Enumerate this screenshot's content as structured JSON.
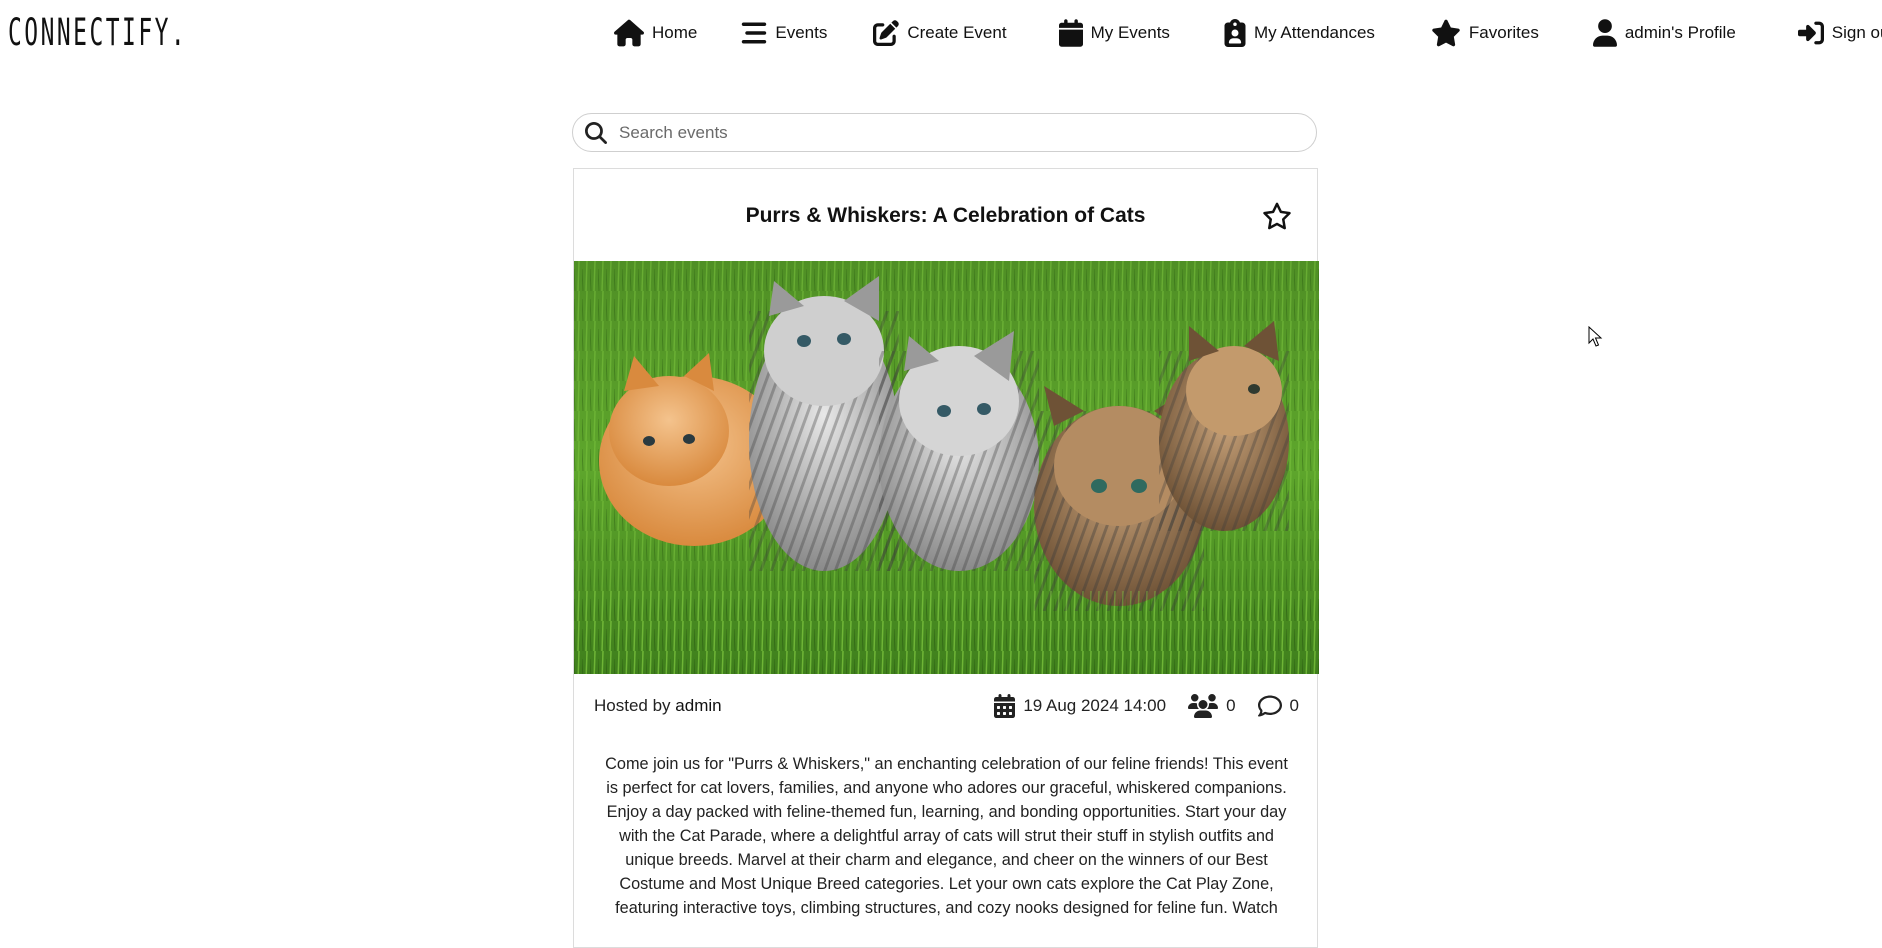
{
  "brand": {
    "name": "CONNECTIFY."
  },
  "nav": {
    "home": "Home",
    "events": "Events",
    "create_event": "Create Event",
    "my_events": "My Events",
    "my_attendances": "My Attendances",
    "favorites": "Favorites",
    "profile": "admin's Profile",
    "sign_out": "Sign out"
  },
  "search": {
    "placeholder": "Search events",
    "value": ""
  },
  "event": {
    "title": "Purrs & Whiskers: A Celebration of Cats",
    "image_alt": "Five kittens on grass",
    "hosted_by_label": "Hosted by",
    "host": "admin",
    "date": "19 Aug 2024 14:00",
    "attendees_count": "0",
    "comments_count": "0",
    "favorited": false,
    "description": "Come join us for \"Purrs & Whiskers,\" an enchanting celebration of our feline friends! This event is perfect for cat lovers, families, and anyone who adores our graceful, whiskered companions. Enjoy a day packed with feline-themed fun, learning, and bonding opportunities.  Start your day with the Cat Parade, where a delightful array of cats will strut their stuff in stylish outfits and unique breeds. Marvel at their charm and elegance, and cheer on the winners of our Best Costume and Most Unique Breed categories.  Let your own cats explore the Cat Play Zone, featuring interactive toys, climbing structures, and cozy nooks designed for feline fun. Watch"
  },
  "icons": {
    "home": "home-icon",
    "events": "list-icon",
    "create": "edit-icon",
    "my_events": "calendar-icon",
    "attendances": "clipboard-user-icon",
    "favorites": "star-solid-icon",
    "profile": "user-icon",
    "sign_out": "sign-in-icon",
    "search": "search-icon",
    "favorite_toggle": "star-outline-icon",
    "date": "calendar-icon",
    "attendees": "users-icon",
    "comments": "comment-icon"
  }
}
